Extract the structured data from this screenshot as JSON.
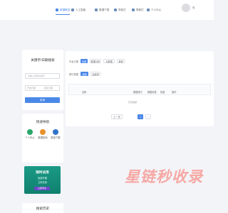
{
  "colors": {
    "accent": "#4a88e8",
    "background": "#f3f4f8",
    "nav_icon": "#6b8fb8",
    "promo_bg": "#1a9a86",
    "promo_button": "#6c46c9",
    "watermark": "#f6a8a4"
  },
  "nav": {
    "items": [
      {
        "label": "数据概览",
        "active": true
      },
      {
        "label": "人工智能",
        "active": false
      },
      {
        "label": "数据下载",
        "active": false
      },
      {
        "label": "导航栏",
        "active": false
      },
      {
        "label": "帮助栏",
        "active": false
      },
      {
        "label": "个人中心",
        "active": false
      }
    ],
    "user_label": "登"
  },
  "search_panel": {
    "title": "关键字/日期搜索",
    "keyword_placeholder": "请输入搜索关键字",
    "start_placeholder": "开始日期",
    "end_placeholder": "结束日期",
    "search_button": "查询"
  },
  "quick_nav": {
    "title": "快速导航",
    "items": [
      {
        "label": "个人中心",
        "color": "#2aa56a",
        "icon": "user-icon"
      },
      {
        "label": "数据查询",
        "color": "#e8902a",
        "icon": "search-icon"
      },
      {
        "label": "数量下载",
        "color": "#2f72c8",
        "icon": "download-icon"
      }
    ]
  },
  "promo": {
    "title": "限时试用",
    "line1": "免费开通",
    "line2": "立即试用",
    "button": "立即申请"
  },
  "filters": {
    "row1_label": "平台分类",
    "row1_tags": [
      "全部",
      "数据分析",
      "大数据",
      "其他"
    ],
    "row1_active": 0,
    "row2_label": "排行类型",
    "row2_tags": [
      "全部",
      "全部排"
    ],
    "row2_active": 0
  },
  "table": {
    "columns": [
      "名称",
      "数据排行",
      "数据标签",
      "热度",
      "操作"
    ],
    "empty_text": "暂无数据"
  },
  "pagination": {
    "prev_label": "上一页",
    "next_label": "下一页",
    "current_page": "1"
  },
  "bottom_panel": {
    "title": "搜索历史"
  },
  "watermark": "星链秒收录"
}
